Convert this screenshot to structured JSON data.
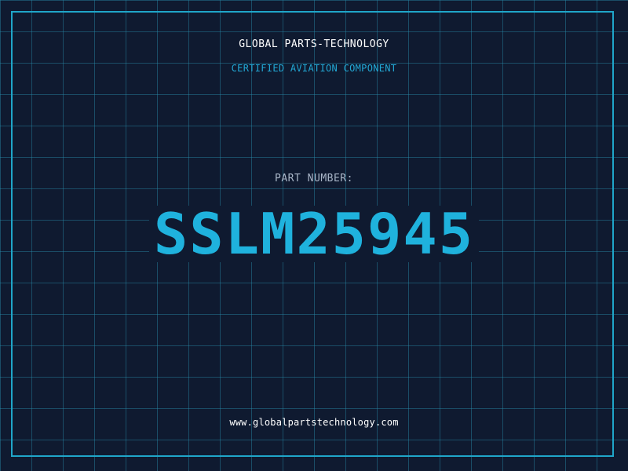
{
  "header": {
    "company_name": "GLOBAL PARTS-TECHNOLOGY",
    "subtitle": "CERTIFIED AVIATION COMPONENT"
  },
  "part": {
    "label": "PART NUMBER:",
    "number": "SSLM25945"
  },
  "footer": {
    "website": "www.globalpartstechnology.com"
  },
  "colors": {
    "background": "#0f1a30",
    "grid": "#288caa",
    "accent": "#1fb2dd",
    "frame": "#1fa6c9",
    "text": "#ffffff",
    "muted": "#a9b6c8"
  }
}
